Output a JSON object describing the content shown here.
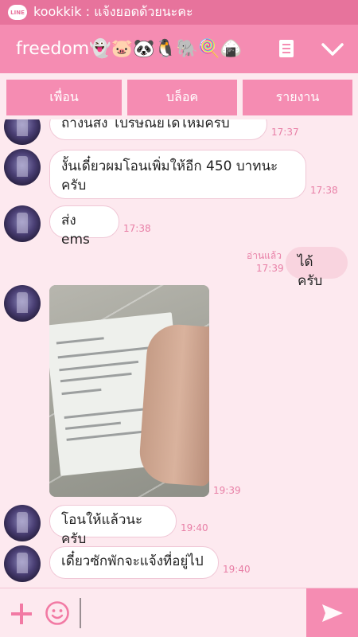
{
  "status_bar": {
    "app_badge": "LINE",
    "notification": "kookkik : แจ้งยอดด้วยนะคะ"
  },
  "header": {
    "title": "freedom👻🐷🐼🐧🐘🍭🍙",
    "note_icon": "note-icon",
    "collapse_icon": "chevron-down-icon"
  },
  "tabs": [
    {
      "label": "เพื่อน"
    },
    {
      "label": "บล็อค"
    },
    {
      "label": "รายงาน"
    }
  ],
  "messages": [
    {
      "text": "ถ้างั้นส่ง โปรษณีย์ได้ไหมครับ",
      "time": "17:37",
      "from": "them"
    },
    {
      "text": "งั้นเดี๋ยวผมโอนเพิ่มให้อีก 450 บาทนะครับ",
      "time": "17:38",
      "from": "them"
    },
    {
      "text": "ส่ง ems",
      "time": "17:38",
      "from": "them"
    },
    {
      "text": "ได้ครับ",
      "time": "17:39",
      "read": "อ่านแล้ว",
      "from": "me"
    },
    {
      "type": "image",
      "time": "19:39",
      "from": "them"
    },
    {
      "text": "โอนให้แล้วนะครับ",
      "time": "19:40",
      "from": "them"
    },
    {
      "text": "เดี๋ยวซักพักจะแจ้งที่อยู่ไป",
      "time": "19:40",
      "from": "them"
    }
  ],
  "composer": {
    "placeholder": "",
    "plus_icon": "plus-icon",
    "emoji_icon": "smiley-icon",
    "send_icon": "send-icon"
  },
  "colors": {
    "header": "#f58cb2",
    "status": "#e7739c",
    "background": "#fde9ef",
    "time": "#e87fa6"
  }
}
